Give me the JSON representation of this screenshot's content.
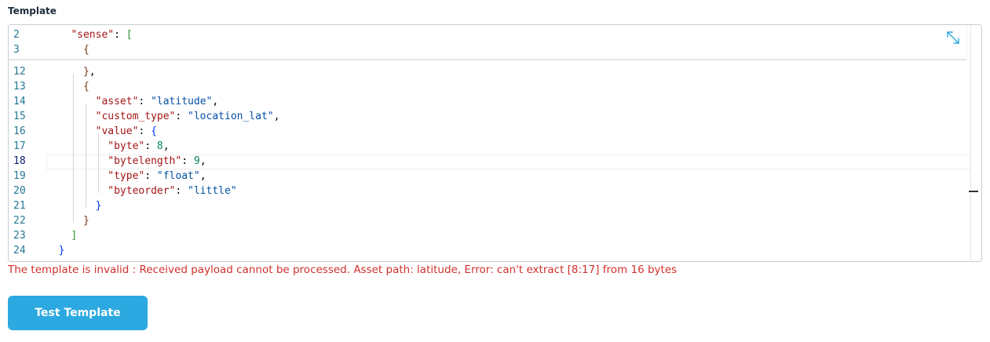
{
  "section": {
    "label": "Template"
  },
  "editor": {
    "sticky_lines": [
      {
        "num": "2",
        "tokens": [
          {
            "t": "    ",
            "c": "p"
          },
          {
            "t": "\"sense\"",
            "c": "k"
          },
          {
            "t": ": ",
            "c": "p"
          },
          {
            "t": "[",
            "c": "b2"
          }
        ]
      },
      {
        "num": "3",
        "tokens": [
          {
            "t": "      ",
            "c": "p"
          },
          {
            "t": "{",
            "c": "b3"
          }
        ]
      }
    ],
    "lines": [
      {
        "num": "12",
        "tokens": [
          {
            "t": "      ",
            "c": "p"
          },
          {
            "t": "}",
            "c": "b3"
          },
          {
            "t": ",",
            "c": "p"
          }
        ]
      },
      {
        "num": "13",
        "tokens": [
          {
            "t": "      ",
            "c": "p"
          },
          {
            "t": "{",
            "c": "b3"
          }
        ]
      },
      {
        "num": "14",
        "tokens": [
          {
            "t": "        ",
            "c": "p"
          },
          {
            "t": "\"asset\"",
            "c": "k"
          },
          {
            "t": ": ",
            "c": "p"
          },
          {
            "t": "\"latitude\"",
            "c": "s"
          },
          {
            "t": ",",
            "c": "p"
          }
        ]
      },
      {
        "num": "15",
        "tokens": [
          {
            "t": "        ",
            "c": "p"
          },
          {
            "t": "\"custom_type\"",
            "c": "k"
          },
          {
            "t": ": ",
            "c": "p"
          },
          {
            "t": "\"location_lat\"",
            "c": "s"
          },
          {
            "t": ",",
            "c": "p"
          }
        ]
      },
      {
        "num": "16",
        "tokens": [
          {
            "t": "        ",
            "c": "p"
          },
          {
            "t": "\"value\"",
            "c": "k"
          },
          {
            "t": ": ",
            "c": "p"
          },
          {
            "t": "{",
            "c": "b1"
          }
        ]
      },
      {
        "num": "17",
        "tokens": [
          {
            "t": "          ",
            "c": "p"
          },
          {
            "t": "\"byte\"",
            "c": "k"
          },
          {
            "t": ": ",
            "c": "p"
          },
          {
            "t": "8",
            "c": "n"
          },
          {
            "t": ",",
            "c": "p"
          }
        ]
      },
      {
        "num": "18",
        "tokens": [
          {
            "t": "          ",
            "c": "p"
          },
          {
            "t": "\"bytelength\"",
            "c": "k"
          },
          {
            "t": ": ",
            "c": "p"
          },
          {
            "t": "9",
            "c": "n"
          },
          {
            "t": ",",
            "c": "p"
          }
        ]
      },
      {
        "num": "19",
        "tokens": [
          {
            "t": "          ",
            "c": "p"
          },
          {
            "t": "\"type\"",
            "c": "k"
          },
          {
            "t": ": ",
            "c": "p"
          },
          {
            "t": "\"float\"",
            "c": "s"
          },
          {
            "t": ",",
            "c": "p"
          }
        ]
      },
      {
        "num": "20",
        "tokens": [
          {
            "t": "          ",
            "c": "p"
          },
          {
            "t": "\"byteorder\"",
            "c": "k"
          },
          {
            "t": ": ",
            "c": "p"
          },
          {
            "t": "\"little\"",
            "c": "s"
          }
        ]
      },
      {
        "num": "21",
        "tokens": [
          {
            "t": "        ",
            "c": "p"
          },
          {
            "t": "}",
            "c": "b1"
          }
        ]
      },
      {
        "num": "22",
        "tokens": [
          {
            "t": "      ",
            "c": "p"
          },
          {
            "t": "}",
            "c": "b3"
          }
        ]
      },
      {
        "num": "23",
        "tokens": [
          {
            "t": "    ",
            "c": "p"
          },
          {
            "t": "]",
            "c": "b2"
          }
        ]
      },
      {
        "num": "24",
        "tokens": [
          {
            "t": "  ",
            "c": "p"
          },
          {
            "t": "}",
            "c": "b1"
          }
        ]
      }
    ],
    "active_line": "18",
    "hidden_line_stub": "11",
    "expand_icon": "expand-arrows-icon"
  },
  "error": {
    "message": "The template is invalid : Received payload cannot be processed. Asset path: latitude, Error: can't extract [8:17] from 16 bytes"
  },
  "actions": {
    "test_label": "Test Template"
  },
  "colors": {
    "error": "#d0312d",
    "button": "#2ba9e0",
    "line_number": "#237893"
  }
}
